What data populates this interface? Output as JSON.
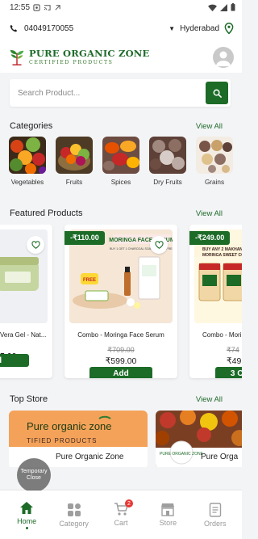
{
  "status_bar": {
    "time": "12:55"
  },
  "header": {
    "phone": "04049170055",
    "location": "Hyderabad"
  },
  "brand": {
    "title": "PURE ORGANIC ZONE",
    "subtitle": "CERTIFIED PRODUCTS"
  },
  "search": {
    "placeholder": "Search Product..."
  },
  "categories": {
    "title": "Categories",
    "view_all": "View All",
    "items": [
      {
        "label": "Vegetables"
      },
      {
        "label": "Fruits"
      },
      {
        "label": "Spices"
      },
      {
        "label": "Dry Fruits"
      },
      {
        "label": "Grains"
      }
    ]
  },
  "featured": {
    "title": "Featured Products",
    "view_all": "View All",
    "products": [
      {
        "name": "Vera Gel - Nat...",
        "price": "5.00",
        "add": "dd"
      },
      {
        "discount": "-₹110.00",
        "name": "Combo - Moringa Face Serum",
        "mrp": "₹709.00",
        "price": "₹599.00",
        "add": "Add",
        "image_text": "MORINGA FACE SERUM",
        "image_subtext": "BUY 1 GET 1 CHARCOAL SOAP OF 40 90 FREE"
      },
      {
        "discount": "-₹249.00",
        "name": "Combo - Mori",
        "mrp": "₹74",
        "price": "₹49",
        "add": "3 Op",
        "image_text": "BUY ANY 2 MAKHAN MORINGA SWEET CO"
      }
    ]
  },
  "top_store": {
    "title": "Top Store",
    "view_all": "View All",
    "stores": [
      {
        "name": "Pure Organic Zone",
        "banner": "Pure organic zone",
        "banner_sub": "TIFIED PRODUCTS"
      },
      {
        "name": "Pure Orga"
      }
    ]
  },
  "temp_close": {
    "line1": "Temporary",
    "line2": "Close"
  },
  "bottom_nav": {
    "items": [
      {
        "label": "Home"
      },
      {
        "label": "Category"
      },
      {
        "label": "Cart",
        "badge": "2"
      },
      {
        "label": "Store"
      },
      {
        "label": "Orders"
      }
    ]
  },
  "colors": {
    "primary": "#1c6b27",
    "badge": "#e53935",
    "background": "#f3f4f6"
  }
}
